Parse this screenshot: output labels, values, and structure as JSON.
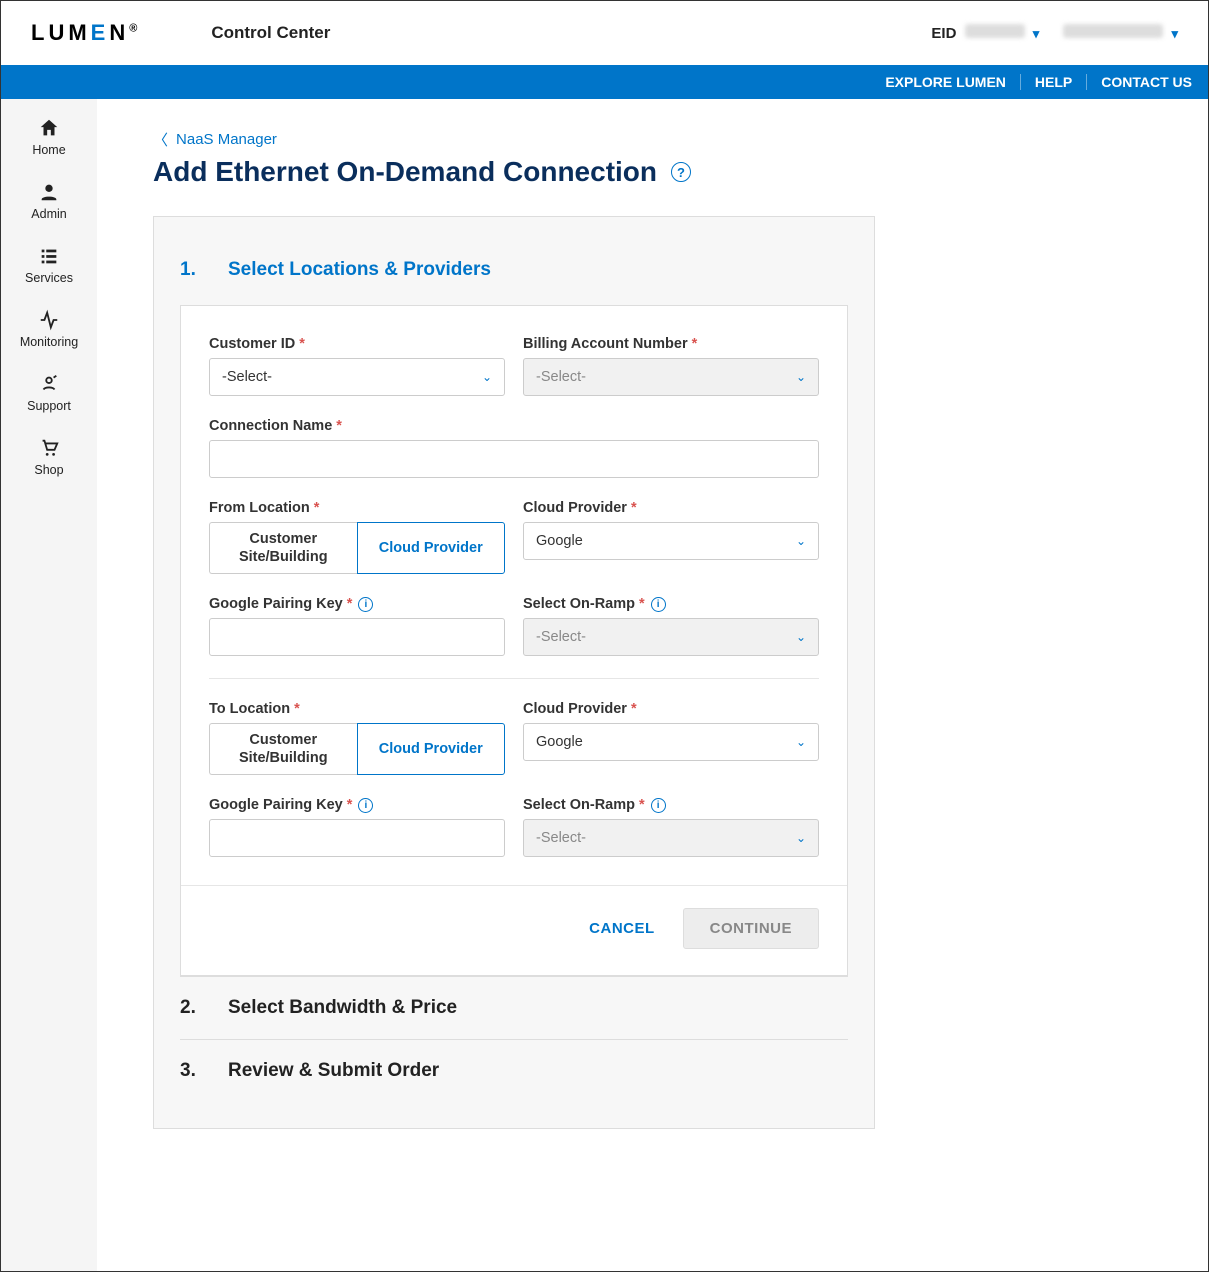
{
  "header": {
    "logo_text_pre": "LUM",
    "logo_text_accent": "E",
    "logo_text_post": "N",
    "logo_suffix": "®",
    "app_title": "Control Center",
    "eid_label": "EID"
  },
  "topnav": {
    "explore": "EXPLORE LUMEN",
    "help": "HELP",
    "contact": "CONTACT US"
  },
  "sidebar": {
    "items": [
      {
        "label": "Home"
      },
      {
        "label": "Admin"
      },
      {
        "label": "Services"
      },
      {
        "label": "Monitoring"
      },
      {
        "label": "Support"
      },
      {
        "label": "Shop"
      }
    ]
  },
  "breadcrumb": {
    "back_label": "NaaS Manager"
  },
  "page": {
    "title": "Add Ethernet On-Demand Connection"
  },
  "wizard": {
    "step1": {
      "num": "1.",
      "title": "Select Locations & Providers",
      "customer_id_label": "Customer ID",
      "customer_id_value": "-Select-",
      "billing_label": "Billing Account Number",
      "billing_value": "-Select-",
      "conn_name_label": "Connection Name",
      "conn_name_value": "",
      "from_location_label": "From Location",
      "to_location_label": "To Location",
      "toggle_customer": "Customer Site/Building",
      "toggle_cloud": "Cloud Provider",
      "cloud_provider_label": "Cloud Provider",
      "cloud_provider_value": "Google",
      "pairing_key_label": "Google Pairing Key",
      "pairing_key_value": "",
      "onramp_label": "Select On-Ramp",
      "onramp_value": "-Select-",
      "cancel": "CANCEL",
      "continue": "CONTINUE"
    },
    "step2": {
      "num": "2.",
      "title": "Select Bandwidth & Price"
    },
    "step3": {
      "num": "3.",
      "title": "Review & Submit Order"
    }
  }
}
